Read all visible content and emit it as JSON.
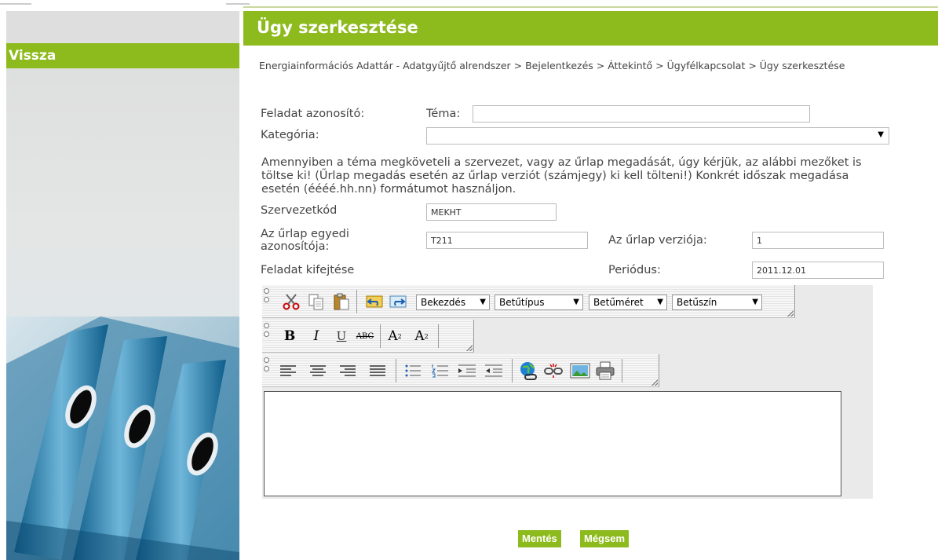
{
  "page": {
    "title": "Ügy szerkesztése"
  },
  "sidebar": {
    "back_label": "Vissza"
  },
  "breadcrumb": "Energiainformációs Adattár - Adatgyűjtő alrendszer > Bejelentkezés > Áttekintő > Ügyfélkapcsolat > Ügy szerkesztése",
  "form": {
    "task_id_label": "Feladat azonosító:",
    "topic_label": "Téma:",
    "topic_value": "",
    "category_label": "Kategória:",
    "category_value": "",
    "hint": "Amennyiben a téma megköveteli a szervezet, vagy az űrlap megadását, úgy kérjük, az alábbi mezőket is töltse ki! (Űrlap megadás esetén az űrlap verziót (számjegy) ki kell tölteni!) Konkrét időszak megadása esetén (éééé.hh.nn) formátumot használjon.",
    "org_code_label": "Szervezetkód",
    "org_code_value": "MEKHT",
    "form_id_label": "Az űrlap egyedi azonosítója:",
    "form_id_value": "T211",
    "form_version_label": "Az űrlap verziója:",
    "form_version_value": "1",
    "description_label": "Feladat kifejtése",
    "period_label": "Periódus:",
    "period_value": "2011.12.01"
  },
  "editor": {
    "paragraph": "Bekezdés",
    "font": "Betűtípus",
    "size": "Betűméret",
    "color": "Betűszín",
    "bold": "B",
    "italic": "I",
    "underline": "U",
    "strike": "ABC",
    "superscript": "A",
    "subscript": "A",
    "content": ""
  },
  "actions": {
    "save": "Mentés",
    "cancel": "Mégsem"
  },
  "colors": {
    "accent": "#8dba1c"
  }
}
